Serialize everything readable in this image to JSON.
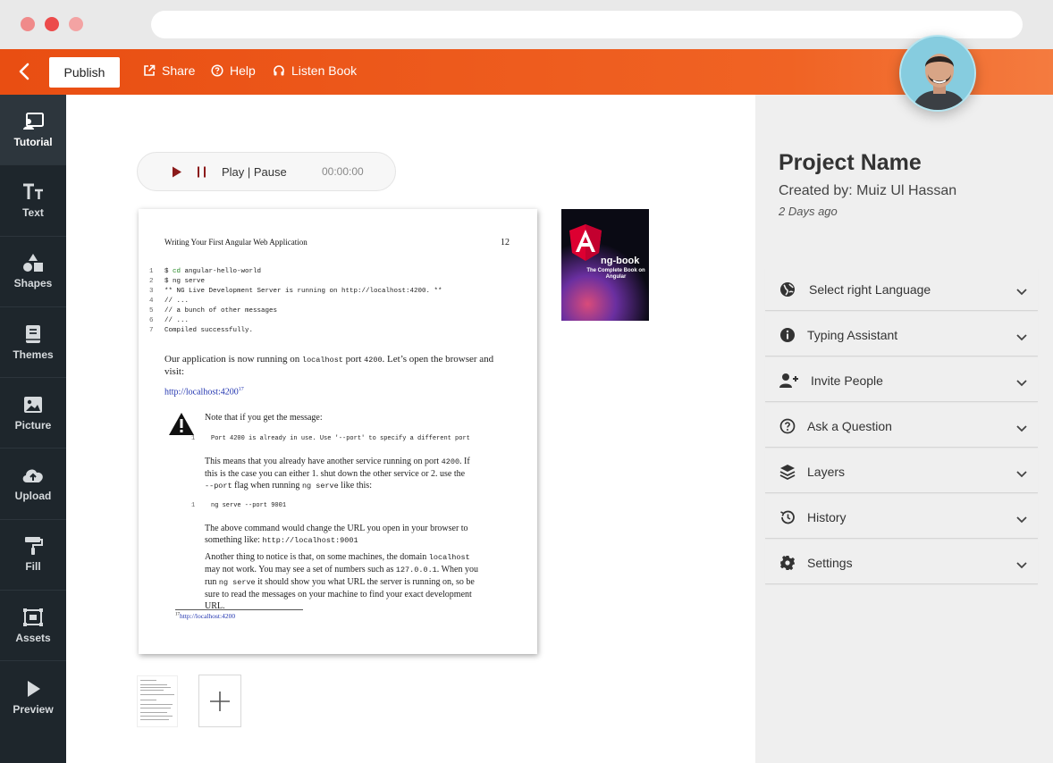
{
  "colors": {
    "accent": "#e94e12",
    "sidebar": "#1e262c",
    "panel": "#efefef"
  },
  "toolbar": {
    "back_icon": "chevron-left-icon",
    "publish_label": "Publish",
    "share_label": "Share",
    "help_label": "Help",
    "listen_label": "Listen Book"
  },
  "sidebar": {
    "items": [
      {
        "label": "Tutorial",
        "icon": "tutorial-icon"
      },
      {
        "label": "Text",
        "icon": "text-size-icon"
      },
      {
        "label": "Shapes",
        "icon": "shapes-icon"
      },
      {
        "label": "Themes",
        "icon": "book-icon"
      },
      {
        "label": "Picture",
        "icon": "image-icon"
      },
      {
        "label": "Upload",
        "icon": "cloud-upload-icon"
      },
      {
        "label": "Fill",
        "icon": "paint-roller-icon"
      },
      {
        "label": "Assets",
        "icon": "assets-icon"
      },
      {
        "label": "Preview",
        "icon": "play-icon"
      }
    ]
  },
  "player": {
    "label": "Play | Pause",
    "time": "00:00:00"
  },
  "document_page": {
    "header": "Writing Your First Angular Web Application",
    "page_number": "12",
    "code": [
      {
        "n": "1",
        "text": "$ cd angular-hello-world"
      },
      {
        "n": "2",
        "text": "$ ng serve"
      },
      {
        "n": "3",
        "text": "** NG Live Development Server is running on http://localhost:4200. **"
      },
      {
        "n": "4",
        "text": "// ..."
      },
      {
        "n": "5",
        "text": "// a bunch of other messages"
      },
      {
        "n": "6",
        "text": "// ..."
      },
      {
        "n": "7",
        "text": "Compiled successfully."
      }
    ],
    "para1_a": "Our application is now running on ",
    "para1_code": "localhost",
    "para1_b": " port ",
    "para1_port": "4200",
    "para1_c": ". Let’s open the browser and",
    "para1_d": "visit:",
    "link": "http://localhost:4200",
    "link_sup": "17",
    "note_title": "Note that if you get the message:",
    "note_code_n": "1",
    "note_code": "Port 4200 is already in use. Use '--port' to specify a different port",
    "para2_l1a": "This means that you already have another service running on port ",
    "para2_l1b": "4200",
    "para2_l1c": ". If",
    "para2_l2": "this is the case you can either 1. shut down the other service or 2. use the",
    "para2_l3a": "--port",
    "para2_l3b": " flag when running ",
    "para2_l3c": "ng serve",
    "para2_l3d": " like this:",
    "serve_n": "1",
    "serve_code": "ng serve --port 9001",
    "para3_l1": "The above command would change the URL you open in your browser to",
    "para3_l2a": "something like: ",
    "para3_l2b": "http://localhost:9001",
    "para4_l1a": "Another thing to notice is that, on some machines, the domain ",
    "para4_l1b": "localhost",
    "para4_l2a": "may not work. You may see a set of numbers such as ",
    "para4_l2b": "127.0.0.1",
    "para4_l2c": ". When you",
    "para4_l3a": "run ",
    "para4_l3b": "ng serve",
    "para4_l3c": " it should show you what URL the server is running on, so be",
    "para4_l4": "sure to read the messages on your machine to find your exact development",
    "para4_l5": "URL.",
    "footnote_num": "17",
    "footnote_link": "http://localhost:4200"
  },
  "book_cover": {
    "title": "ng-book",
    "subtitle": "The Complete Book on Angular"
  },
  "project": {
    "title": "Project Name",
    "creator": "Created by: Muiz Ul Hassan",
    "date": "2 Days ago"
  },
  "panel_items": [
    {
      "label": "Select right Language",
      "icon": "globe-icon"
    },
    {
      "label": "Typing Assistant",
      "icon": "info-icon"
    },
    {
      "label": "Invite People",
      "icon": "user-plus-icon"
    },
    {
      "label": "Ask a Question",
      "icon": "question-icon"
    },
    {
      "label": "Layers",
      "icon": "layers-icon"
    },
    {
      "label": "History",
      "icon": "history-icon"
    },
    {
      "label": "Settings",
      "icon": "gear-icon"
    }
  ]
}
